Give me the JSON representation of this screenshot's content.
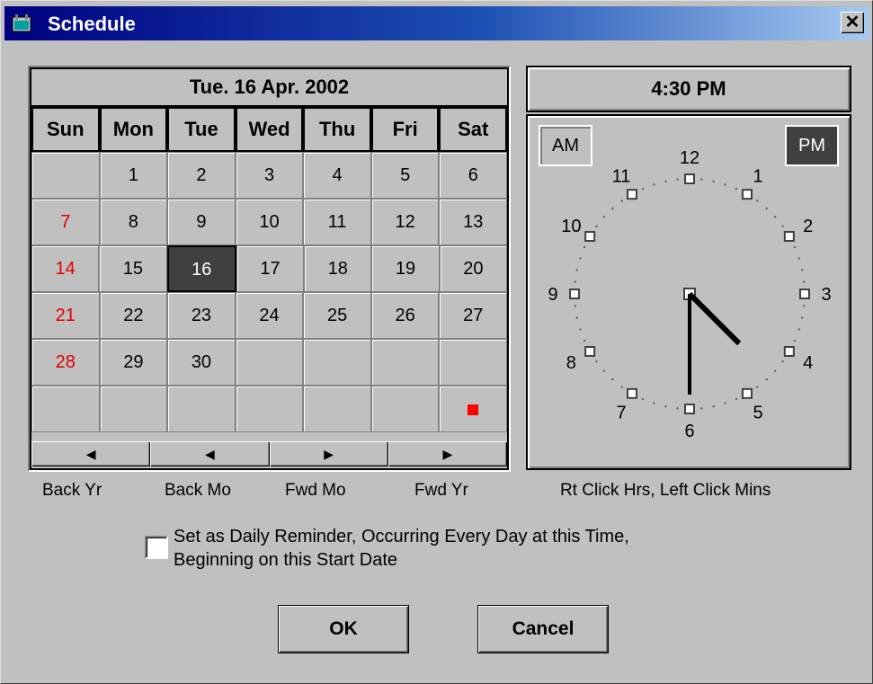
{
  "window": {
    "title": "Schedule",
    "close_glyph": "✕"
  },
  "calendar": {
    "current_date": "Tue. 16 Apr. 2002",
    "weekdays": [
      "Sun",
      "Mon",
      "Tue",
      "Wed",
      "Thu",
      "Fri",
      "Sat"
    ],
    "weeks": [
      [
        "",
        "1",
        "2",
        "3",
        "4",
        "5",
        "6"
      ],
      [
        "7",
        "8",
        "9",
        "10",
        "11",
        "12",
        "13"
      ],
      [
        "14",
        "15",
        "16",
        "17",
        "18",
        "19",
        "20"
      ],
      [
        "21",
        "22",
        "23",
        "24",
        "25",
        "26",
        "27"
      ],
      [
        "28",
        "29",
        "30",
        "",
        "",
        "",
        ""
      ],
      [
        "",
        "",
        "",
        "",
        "",
        "",
        ""
      ]
    ],
    "selected_day": "16",
    "sunday_color": "#e00000",
    "marker_color": "#ff0000",
    "nav_buttons": [
      {
        "glyph": "◀",
        "label": "Back Yr"
      },
      {
        "glyph": "◀",
        "label": "Back Mo"
      },
      {
        "glyph": "▶",
        "label": "Fwd Mo"
      },
      {
        "glyph": "▶",
        "label": "Fwd Yr"
      }
    ]
  },
  "clock": {
    "time_display": "4:30 PM",
    "am_label": "AM",
    "pm_label": "PM",
    "selected_period": "PM",
    "numbers": [
      "12",
      "1",
      "2",
      "3",
      "4",
      "5",
      "6",
      "7",
      "8",
      "9",
      "10",
      "11"
    ],
    "hour": 4,
    "minute": 30,
    "hint": "Rt Click Hrs, Left Click Mins"
  },
  "reminder": {
    "checked": false,
    "label_line1": "Set as Daily Reminder, Occurring Every Day at this Time,",
    "label_line2": "Beginning on this Start Date"
  },
  "buttons": {
    "ok": "OK",
    "cancel": "Cancel"
  }
}
